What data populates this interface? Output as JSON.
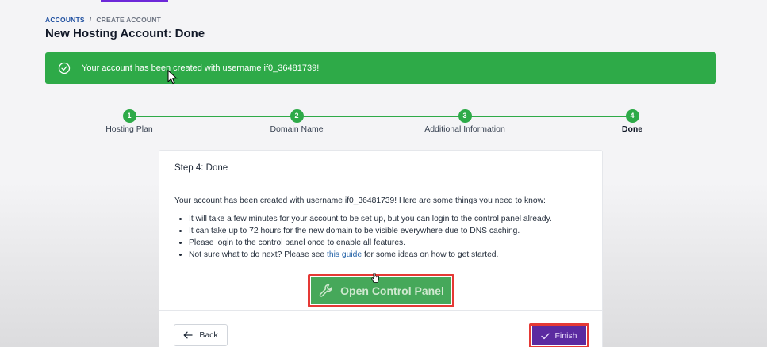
{
  "breadcrumb": {
    "parent": "ACCOUNTS",
    "separator": "/",
    "current": "CREATE ACCOUNT"
  },
  "page": {
    "title": "New Hosting Account: Done"
  },
  "alert": {
    "message": "Your account has been created with username if0_36481739!",
    "color": "#2eaa48"
  },
  "stepper": {
    "steps": [
      {
        "number": "1",
        "label": "Hosting Plan"
      },
      {
        "number": "2",
        "label": "Domain Name"
      },
      {
        "number": "3",
        "label": "Additional Information"
      },
      {
        "number": "4",
        "label": "Done"
      }
    ],
    "active_step": "4"
  },
  "card": {
    "header": "Step 4: Done",
    "intro": "Your account has been created with username if0_36481739! Here are some things you need to know:",
    "bullets": [
      "It will take a few minutes for your account to be set up, but you can login to the control panel already.",
      "It can take up to 72 hours for the new domain to be visible everywhere due to DNS caching.",
      "Please login to the control panel once to enable all features."
    ],
    "last_bullet": {
      "before": "Not sure what to do next? Please see ",
      "link": "this guide",
      "after": " for some ideas on how to get started."
    },
    "open_control_panel_label": "Open Control Panel",
    "back_label": "Back",
    "finish_label": "Finish"
  },
  "colors": {
    "success": "#2eaa48",
    "primary": "#5b2aa0",
    "highlight": "#e53935",
    "link": "#2563a8"
  }
}
